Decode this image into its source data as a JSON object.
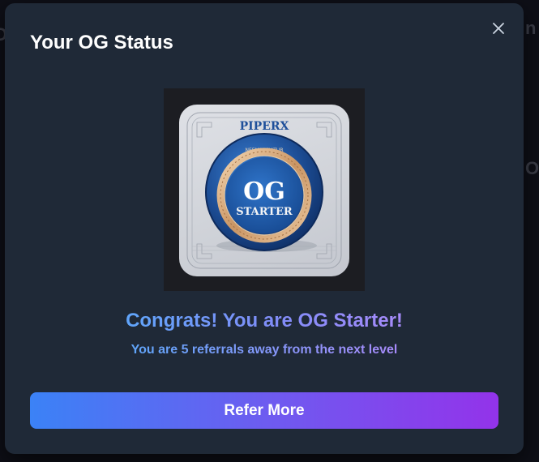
{
  "modal": {
    "title": "Your OG Status",
    "close_icon": "close-icon"
  },
  "badge": {
    "brand": "PIPERX",
    "ring_text": "NEEMASCIATUR",
    "level_short": "OG",
    "level_word": "STARTER"
  },
  "status": {
    "congrats": "Congrats! You are OG Starter!",
    "progress_text": "You are 5 referrals away from the next level"
  },
  "actions": {
    "refer_label": "Refer More"
  },
  "colors": {
    "modal_bg": "#1f2937",
    "button_gradient_start": "#3b82f6",
    "button_gradient_end": "#9333ea",
    "text_gradient_start": "#60a5fa",
    "text_gradient_end": "#a78bfa",
    "badge_blue": "#1e5aa8",
    "badge_gold": "#d4a373"
  }
}
